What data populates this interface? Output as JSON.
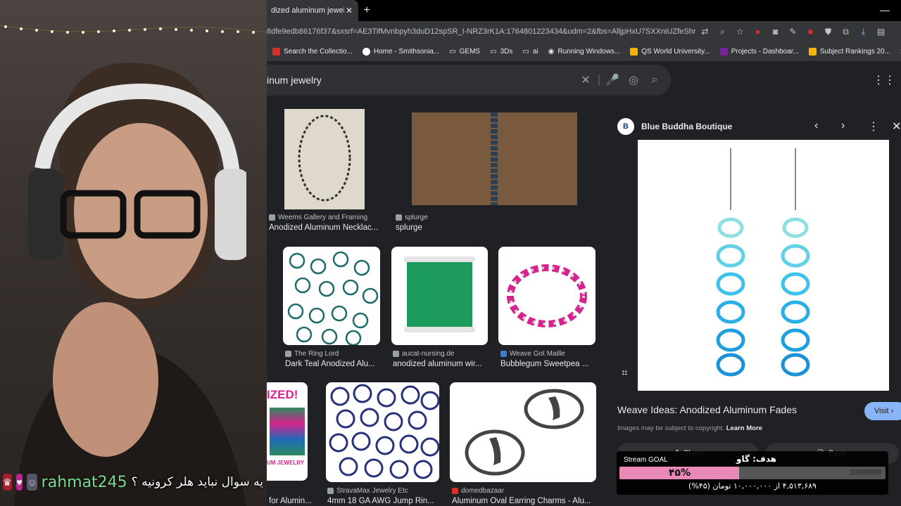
{
  "browser": {
    "tab_title": "dized aluminum jewelry - G",
    "tab_close": "✕",
    "new_tab": "+",
    "minimize": "—",
    "url": "8dfe9edb86176f37&sxsrf=AE3TifMvnbpyh3duD12spSR_I-NRZ3rK1A:1764801223434&udm=2&fbs=AlljpHxU7SXXniUZfeShr2fp4giZ1Y6..."
  },
  "bookmarks": [
    {
      "label": "Search the Collectio...",
      "color": "#d93025"
    },
    {
      "label": "Home - Smithsonia...",
      "color": "#ffffff"
    },
    {
      "label": "GEMS",
      "color": "#9aa0a6"
    },
    {
      "label": "3Ds",
      "color": "#9aa0a6"
    },
    {
      "label": "ai",
      "color": "#9aa0a6"
    },
    {
      "label": "Running Windows...",
      "color": "#e8eaed"
    },
    {
      "label": "QS World University...",
      "color": "#f4b400"
    },
    {
      "label": "Projects - Dashboar...",
      "color": "#7b1fa2"
    },
    {
      "label": "Subject Rankings 20...",
      "color": "#f4b400"
    }
  ],
  "search": {
    "query": "inum jewelry"
  },
  "results": [
    {
      "source": "Weems Gallery and Framing",
      "caption": "Anodized Aluminum Necklac..."
    },
    {
      "source": "splurge",
      "caption": "splurge"
    },
    {
      "source": "The Ring Lord",
      "caption": "Dark Teal Anodized Alu..."
    },
    {
      "source": "aucat-nursing.de",
      "caption": "anodized aluminum wir..."
    },
    {
      "source": "Weave Got Maille",
      "caption": "Bubblegum Sweetpea ..."
    },
    {
      "source": "",
      "caption": "for Alumin..."
    },
    {
      "source": "StravaMax Jewelry Etc",
      "caption": "4mm 18 GA AWG Jump Rin..."
    },
    {
      "source": "domedbazaar",
      "caption": "Aluminum Oval Earring Charms - Alu..."
    }
  ],
  "thumb_text": {
    "ized": "IZED!",
    "jewelry": "UM JEWELRY"
  },
  "panel": {
    "site_name": "Blue Buddha Boutique",
    "site_logo": "B",
    "title": "Weave Ideas: Anodized Aluminum Fades",
    "copyright": "Images may be subject to copyright.",
    "learn_more": "Learn More",
    "visit": "Visit ›",
    "share": "Share",
    "save": "Save"
  },
  "chat": {
    "username": "rahmat245",
    "message": "یه سوال نباید هلر کرونیه ؟"
  },
  "goal": {
    "label": "Stream GOAL",
    "title": "هدف: گاو",
    "percent_label": "۴۵%",
    "progress": 0.45,
    "target": "10000000",
    "description": "۴,۵۱۳,۶۸۹ از ۱۰,۰۰۰,۰۰۰ تومان (۴۵%)"
  },
  "colors": {
    "goal_fill": "#e889b8",
    "chat_name": "#7bd88f",
    "visit_button": "#8ab4f8"
  }
}
